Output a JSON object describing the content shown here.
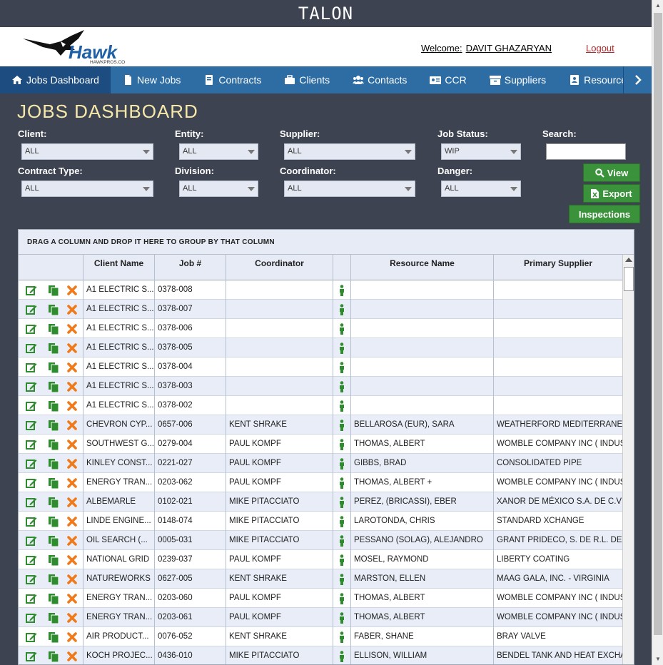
{
  "app": {
    "title": "TALON"
  },
  "header": {
    "logo_text": "Hawk",
    "logo_sub": "HAWKPROS.COM",
    "welcome_label": "Welcome:",
    "user_name": "DAVIT GHAZARYAN",
    "logout_label": "Logout"
  },
  "nav": {
    "items": [
      {
        "label": "Jobs Dashboard",
        "icon": "home-icon"
      },
      {
        "label": "New Jobs",
        "icon": "file-icon"
      },
      {
        "label": "Contracts",
        "icon": "book-icon"
      },
      {
        "label": "Clients",
        "icon": "briefcase-icon"
      },
      {
        "label": "Contacts",
        "icon": "users-icon"
      },
      {
        "label": "CCR",
        "icon": "id-card-icon"
      },
      {
        "label": "Suppliers",
        "icon": "archive-icon"
      },
      {
        "label": "Resources",
        "icon": "address-book-icon"
      }
    ],
    "active_index": 0
  },
  "page": {
    "title": "JOBS DASHBOARD"
  },
  "filters": {
    "client": {
      "label": "Client:",
      "value": "ALL"
    },
    "entity": {
      "label": "Entity:",
      "value": "ALL"
    },
    "supplier": {
      "label": "Supplier:",
      "value": "ALL"
    },
    "job_status": {
      "label": "Job Status:",
      "value": "WIP"
    },
    "search": {
      "label": "Search:",
      "value": ""
    },
    "contract_type": {
      "label": "Contract Type:",
      "value": "ALL"
    },
    "division": {
      "label": "Division:",
      "value": "ALL"
    },
    "coordinator": {
      "label": "Coordinator:",
      "value": "ALL"
    },
    "danger": {
      "label": "Danger:",
      "value": "ALL"
    }
  },
  "buttons": {
    "view": "View",
    "export": "Export",
    "inspections": "Inspections"
  },
  "grid": {
    "group_hint": "DRAG A COLUMN AND DROP IT HERE TO GROUP BY THAT COLUMN",
    "columns": [
      "Client Name",
      "Job #",
      "Coordinator",
      "Resource Name",
      "Primary Supplier"
    ],
    "rows": [
      {
        "client": "A1 ELECTRIC S...",
        "job": "0378-008",
        "coordinator": "",
        "resource": "",
        "supplier": ""
      },
      {
        "client": "A1 ELECTRIC S...",
        "job": "0378-007",
        "coordinator": "",
        "resource": "",
        "supplier": ""
      },
      {
        "client": "A1 ELECTRIC S...",
        "job": "0378-006",
        "coordinator": "",
        "resource": "",
        "supplier": ""
      },
      {
        "client": "A1 ELECTRIC S...",
        "job": "0378-005",
        "coordinator": "",
        "resource": "",
        "supplier": ""
      },
      {
        "client": "A1 ELECTRIC S...",
        "job": "0378-004",
        "coordinator": "",
        "resource": "",
        "supplier": ""
      },
      {
        "client": "A1 ELECTRIC S...",
        "job": "0378-003",
        "coordinator": "",
        "resource": "",
        "supplier": ""
      },
      {
        "client": "A1 ELECTRIC S...",
        "job": "0378-002",
        "coordinator": "",
        "resource": "",
        "supplier": ""
      },
      {
        "client": "CHEVRON CYP...",
        "job": "0657-006",
        "coordinator": "KENT SHRAKE",
        "resource": "BELLAROSA (EUR), SARA",
        "supplier": "WEATHERFORD MEDITERRANEA"
      },
      {
        "client": "SOUTHWEST G...",
        "job": "0279-004",
        "coordinator": "PAUL KOMPF",
        "resource": "THOMAS, ALBERT",
        "supplier": "WOMBLE COMPANY INC ( INDUS"
      },
      {
        "client": "KINLEY CONST...",
        "job": "0221-027",
        "coordinator": "PAUL KOMPF",
        "resource": "GIBBS, BRAD",
        "supplier": "CONSOLIDATED PIPE"
      },
      {
        "client": "ENERGY TRAN...",
        "job": "0203-062",
        "coordinator": "PAUL KOMPF",
        "resource": "THOMAS, ALBERT +",
        "supplier": "WOMBLE COMPANY INC ( INDUS"
      },
      {
        "client": "ALBEMARLE",
        "job": "0102-021",
        "coordinator": "MIKE PITACCIATO",
        "resource": "PEREZ, (BRICASSI), EBER",
        "supplier": "XANOR DE MÉXICO S.A. DE C.V"
      },
      {
        "client": "LINDE ENGINE...",
        "job": "0148-074",
        "coordinator": "MIKE PITACCIATO",
        "resource": "LAROTONDA, CHRIS",
        "supplier": "STANDARD XCHANGE"
      },
      {
        "client": "OIL SEARCH (...",
        "job": "0005-031",
        "coordinator": "MIKE PITACCIATO",
        "resource": "PESSANO (SOLAG), ALEJANDRO",
        "supplier": "GRANT PRIDECO, S. DE R.L. DE"
      },
      {
        "client": "NATIONAL GRID",
        "job": "0239-037",
        "coordinator": "PAUL KOMPF",
        "resource": "MOSEL, RAYMOND",
        "supplier": "LIBERTY COATING"
      },
      {
        "client": "NATUREWORKS",
        "job": "0627-005",
        "coordinator": "KENT SHRAKE",
        "resource": "MARSTON, ELLEN",
        "supplier": "MAAG GALA, INC. - VIRGINIA"
      },
      {
        "client": "ENERGY TRAN...",
        "job": "0203-060",
        "coordinator": "PAUL KOMPF",
        "resource": "THOMAS, ALBERT",
        "supplier": "WOMBLE COMPANY INC ( INDUS"
      },
      {
        "client": "ENERGY TRAN...",
        "job": "0203-061",
        "coordinator": "PAUL KOMPF",
        "resource": "THOMAS, ALBERT",
        "supplier": "WOMBLE COMPANY INC ( INDUS"
      },
      {
        "client": "AIR PRODUCT...",
        "job": "0076-052",
        "coordinator": "KENT SHRAKE",
        "resource": "FABER, SHANE",
        "supplier": "BRAY VALVE"
      },
      {
        "client": "KOCH PROJEC...",
        "job": "0436-010",
        "coordinator": "MIKE PITACCIATO",
        "resource": "ELLISON, WILLIAM",
        "supplier": "BENDEL TANK AND HEAT EXCHA"
      }
    ]
  },
  "colors": {
    "nav": "#2e6da4",
    "nav_active": "#1d4c80",
    "title": "#f5e8a8",
    "button": "#3a923a",
    "edit_icon": "#2e8b2e",
    "delete_icon": "#f07a1a"
  }
}
